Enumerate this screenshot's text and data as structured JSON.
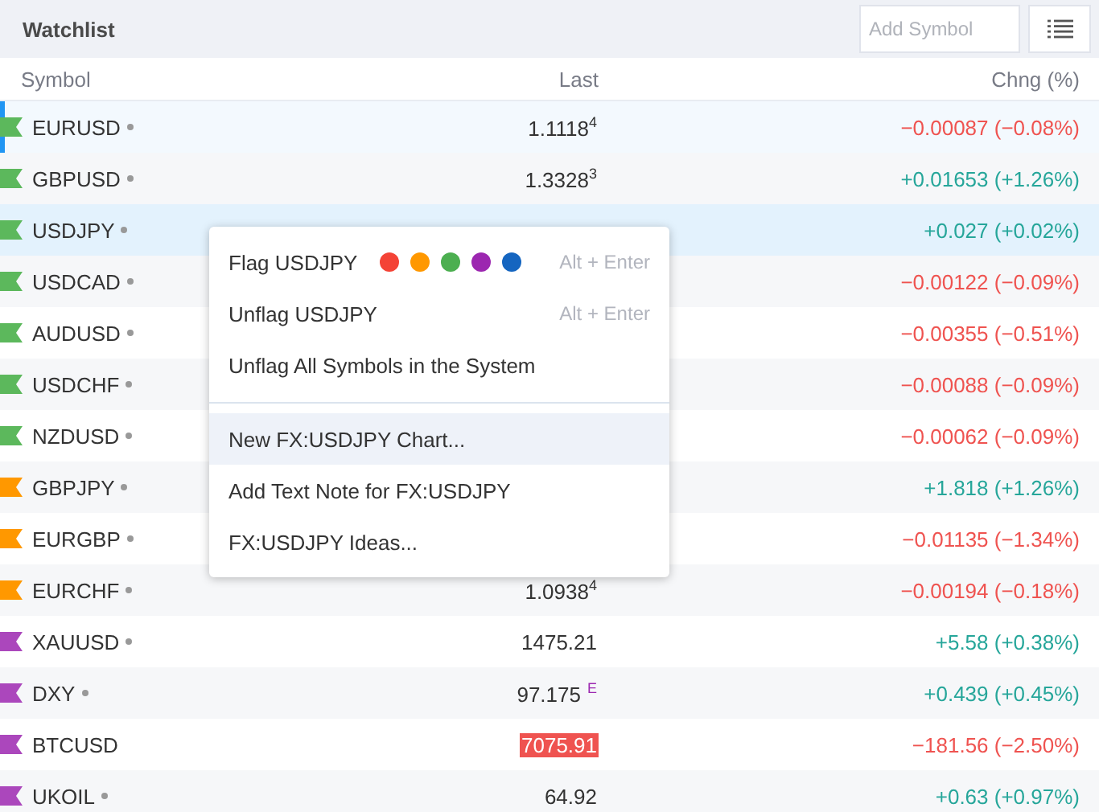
{
  "header": {
    "title": "Watchlist",
    "search": {
      "placeholder": "Add Symbol"
    }
  },
  "columns": [
    "Symbol",
    "Last",
    "Chng (%)"
  ],
  "rows": [
    {
      "symbol": "EURUSD",
      "dot": true,
      "color": "#5cb85c",
      "selected": true,
      "hovered": false,
      "last": "1.1118",
      "last_sup": "4",
      "change": "−0.00087 (−0.08%)",
      "negative": true
    },
    {
      "symbol": "GBPUSD",
      "dot": true,
      "color": "#5cb85c",
      "selected": false,
      "hovered": false,
      "last": "1.3328",
      "last_sup": "3",
      "change": "+0.01653 (+1.26%)",
      "negative": false
    },
    {
      "symbol": "USDJPY",
      "dot": true,
      "color": "#5cb85c",
      "selected": false,
      "hovered": true,
      "change": "+0.027 (+0.02%)",
      "negative": false
    },
    {
      "symbol": "USDCAD",
      "dot": true,
      "color": "#5cb85c",
      "selected": false,
      "hovered": false,
      "change": "−0.00122 (−0.09%)",
      "negative": true
    },
    {
      "symbol": "AUDUSD",
      "dot": true,
      "color": "#5cb85c",
      "selected": false,
      "hovered": false,
      "change": "−0.00355 (−0.51%)",
      "negative": true
    },
    {
      "symbol": "USDCHF",
      "dot": true,
      "color": "#5cb85c",
      "selected": false,
      "hovered": false,
      "change": "−0.00088 (−0.09%)",
      "negative": true
    },
    {
      "symbol": "NZDUSD",
      "dot": true,
      "color": "#5cb85c",
      "selected": false,
      "hovered": false,
      "change": "−0.00062 (−0.09%)",
      "negative": true
    },
    {
      "symbol": "GBPJPY",
      "dot": true,
      "color": "#ff9800",
      "selected": false,
      "hovered": false,
      "change": "+1.818 (+1.26%)",
      "negative": false
    },
    {
      "symbol": "EURGBP",
      "dot": true,
      "color": "#ff9800",
      "selected": false,
      "hovered": false,
      "change": "−0.01135 (−1.34%)",
      "negative": true
    },
    {
      "symbol": "EURCHF",
      "dot": true,
      "color": "#ff9800",
      "selected": false,
      "hovered": false,
      "last": "1.0938",
      "last_sup": "4",
      "change": "−0.00194 (−0.18%)",
      "negative": true
    },
    {
      "symbol": "XAUUSD",
      "dot": true,
      "color": "#ab47bc",
      "selected": false,
      "hovered": false,
      "last": "1475.21",
      "change": "+5.58 (+0.38%)",
      "negative": false
    },
    {
      "symbol": "DXY",
      "dot": true,
      "color": "#ab47bc",
      "selected": false,
      "hovered": false,
      "last": "97.175",
      "last_tag": "E",
      "change": "+0.439 (+0.45%)",
      "negative": false
    },
    {
      "symbol": "BTCUSD",
      "dot": false,
      "color": "#ab47bc",
      "selected": false,
      "hovered": false,
      "last": "7075.91",
      "last_flash": true,
      "change": "−181.56 (−2.50%)",
      "negative": true
    },
    {
      "symbol": "UKOIL",
      "dot": true,
      "color": "#ab47bc",
      "selected": false,
      "hovered": false,
      "last": "64.92",
      "change": "+0.63 (+0.97%)",
      "negative": false
    }
  ],
  "context_menu": {
    "groups": [
      [
        {
          "label": "Flag USDJPY",
          "swatches": [
            {
              "color": "#f44336"
            },
            {
              "color": "#ff9800"
            },
            {
              "color": "#4caf50"
            },
            {
              "color": "#9c27b0"
            },
            {
              "color": "#1565c0"
            }
          ],
          "shortcut": "Alt + Enter",
          "selected": false
        },
        {
          "label": "Unflag USDJPY",
          "shortcut": "Alt + Enter",
          "selected": false
        },
        {
          "label": "Unflag All Symbols in the System",
          "selected": false
        }
      ],
      [
        {
          "label": "New FX:USDJPY Chart...",
          "selected": true
        },
        {
          "label": "Add Text Note for FX:USDJPY",
          "selected": false
        },
        {
          "label": "FX:USDJPY Ideas...",
          "selected": false
        }
      ]
    ]
  }
}
